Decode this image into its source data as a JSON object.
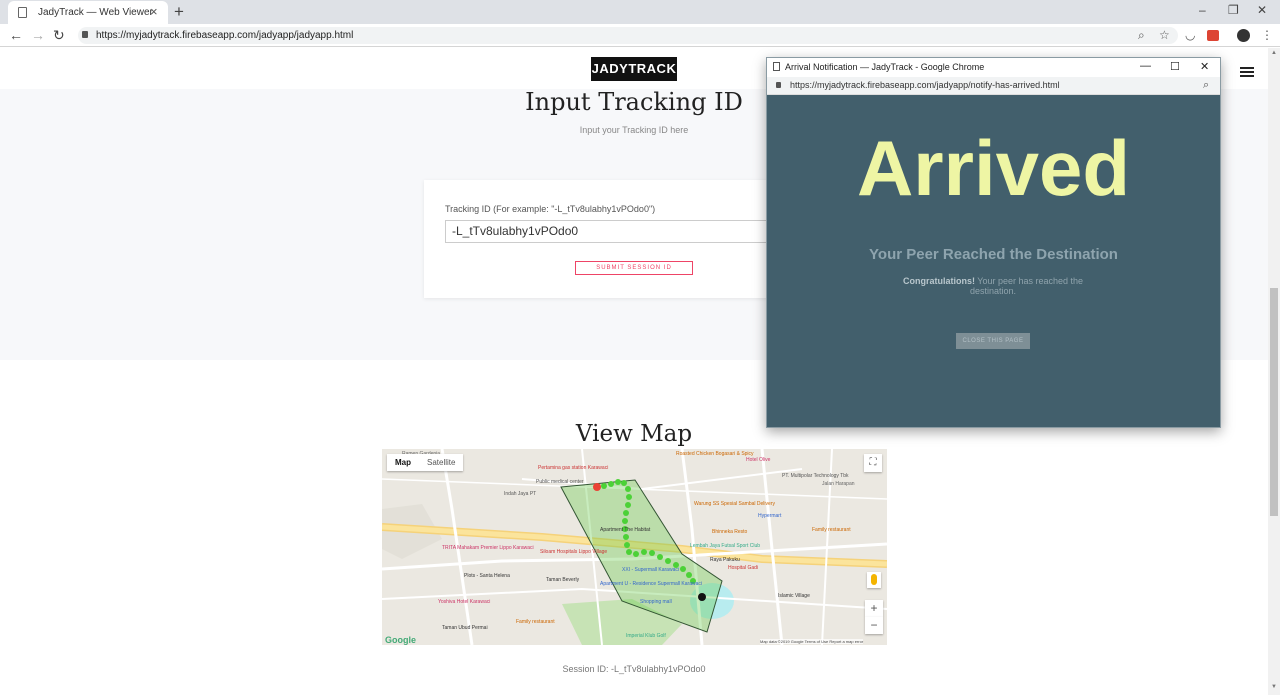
{
  "browser": {
    "tab_title": "JadyTrack — Web Viewer",
    "url": "https://myjadytrack.firebaseapp.com/jadyapp/jadyapp.html",
    "new_tab_icon": "plus-icon",
    "close_icon": "close-icon"
  },
  "page": {
    "logo": "JADYTRACK",
    "heading": "Input Tracking ID",
    "subheading": "Input your Tracking ID here",
    "field_label": "Tracking ID (For example: \"-L_tTv8ulabhy1vPOdo0\")",
    "tracking_id_value": "-L_tTv8ulabhy1vPOdo0",
    "submit_label": "SUBMIT SESSION ID",
    "map_heading": "View Map",
    "session_text": "Session ID: -L_tTv8ulabhy1vPOdo0"
  },
  "map": {
    "type_map": "Map",
    "type_satellite": "Satellite",
    "zoom_in": "+",
    "zoom_out": "−",
    "google": "Google",
    "attribution": "Map data ©2019 Google   Terms of Use   Report a map error",
    "labels": [
      "Ramen Gardenia",
      "Pertamina gas station Karawaci",
      "Indah Jaya PT",
      "Public medical center",
      "Roasted Chicken Bogasari & Spicy",
      "Hotel Olive",
      "PT. Multipolar Technology Tbk",
      "Jalan Harapan",
      "Warung SS Spesial Sambal Delivery",
      "Hypermart",
      "Family restaurant",
      "Bhinneka Resto",
      "Apartment The Habitat",
      "Lembah Jaya Futsal Sport Club",
      "Raya Pakuku",
      "Hospital Gadi",
      "TRITA Mahakam Premier Lippo Karawaci",
      "Siloam Hospitals Lippo Village",
      "Plots - Santa Helena",
      "Taman Beverly",
      "XXI - Supermall Karawaci",
      "Apartment U - Residence Supermall Karawaci",
      "Islamic Village",
      "Yoshiva Hotel Karawaci",
      "Taman Ubud Permai",
      "Family restaurant",
      "Imperial Klub Golf",
      "Shopping mall"
    ]
  },
  "popup": {
    "window_title": "Arrival Notification — JadyTrack - Google Chrome",
    "url": "https://myjadytrack.firebaseapp.com/jadyapp/notify-has-arrived.html",
    "big_text": "Arrived",
    "heading": "Your Peer Reached the Destination",
    "congrats_bold": "Congratulations!",
    "congrats_rest": " Your peer has reached the destination.",
    "close_label": "CLOSE THIS PAGE"
  },
  "colors": {
    "popup_bg": "#425f6c",
    "arrived_text": "#eef5a4",
    "submit_accent": "#e46",
    "route_green": "#4cd137"
  }
}
